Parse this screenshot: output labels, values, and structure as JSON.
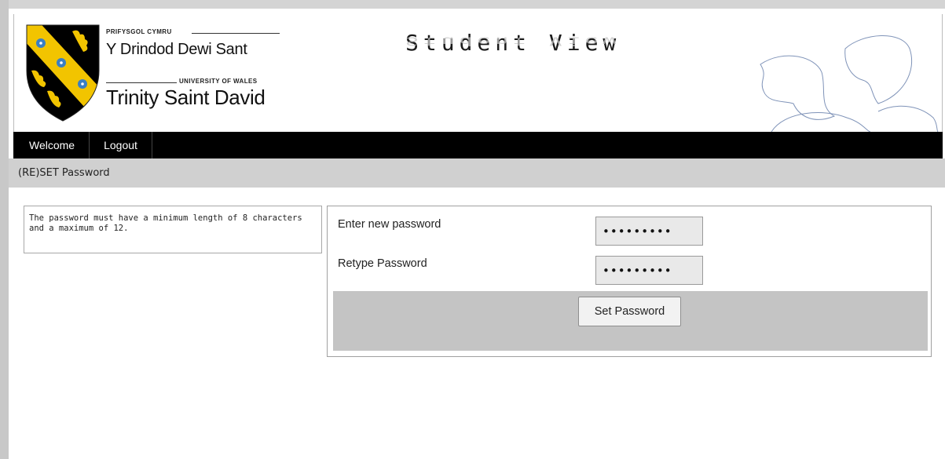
{
  "header": {
    "brand": {
      "welsh_small": "PRIFYSGOL CYMRU",
      "welsh_name": "Y Drindod Dewi Sant",
      "english_small": "UNIVERSITY OF WALES",
      "english_name": "Trinity Saint David"
    },
    "title": "Student View",
    "crest_colors": {
      "shield": "#000000",
      "band": "#f2c400",
      "flower": "#3a7fc4"
    }
  },
  "nav": {
    "items": [
      {
        "label": "Welcome"
      },
      {
        "label": "Logout"
      }
    ]
  },
  "subbar": {
    "title": "(RE)SET Password"
  },
  "info": {
    "text": "The password must have a minimum length of 8 characters and a maximum of 12."
  },
  "form": {
    "new_password": {
      "label": "Enter new password",
      "value": "•••••••••"
    },
    "retype_password": {
      "label": "Retype Password",
      "value": "•••••••••"
    },
    "submit_label": "Set Password"
  },
  "colors": {
    "navbar": "#000000",
    "subbar": "#d0d0d0",
    "form_footer": "#c4c4c4",
    "input_bg": "#e9e9e9"
  }
}
